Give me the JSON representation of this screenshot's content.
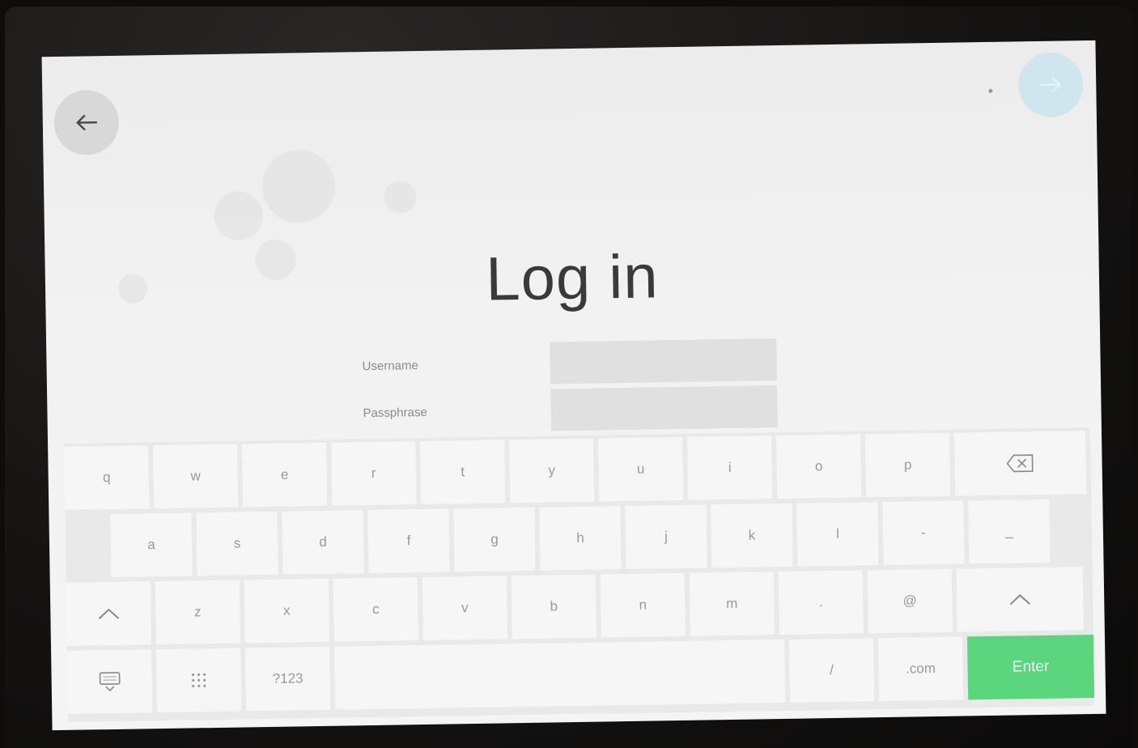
{
  "header": {
    "back_icon": "arrow-left-icon",
    "next_icon": "arrow-right-icon",
    "accent_color": "#cfe6ee"
  },
  "title": "Log in",
  "form": {
    "username_label": "Username",
    "username_value": "",
    "passphrase_label": "Passphrase",
    "passphrase_value": ""
  },
  "keyboard": {
    "row1": [
      "q",
      "w",
      "e",
      "r",
      "t",
      "y",
      "u",
      "i",
      "o",
      "p"
    ],
    "row2": [
      "a",
      "s",
      "d",
      "f",
      "g",
      "h",
      "j",
      "k",
      "l",
      "-",
      "_"
    ],
    "row3": [
      "z",
      "x",
      "c",
      "v",
      "b",
      "n",
      "m",
      ".",
      "@"
    ],
    "symbols_label": "?123",
    "slash_label": "/",
    "dotcom_label": ".com",
    "enter_label": "Enter",
    "enter_color": "#5bd67f",
    "backspace_icon": "backspace-icon",
    "shift_icon": "shift-up-icon",
    "hide_keyboard_icon": "keyboard-hide-icon",
    "numpad_icon": "numpad-grid-icon"
  }
}
